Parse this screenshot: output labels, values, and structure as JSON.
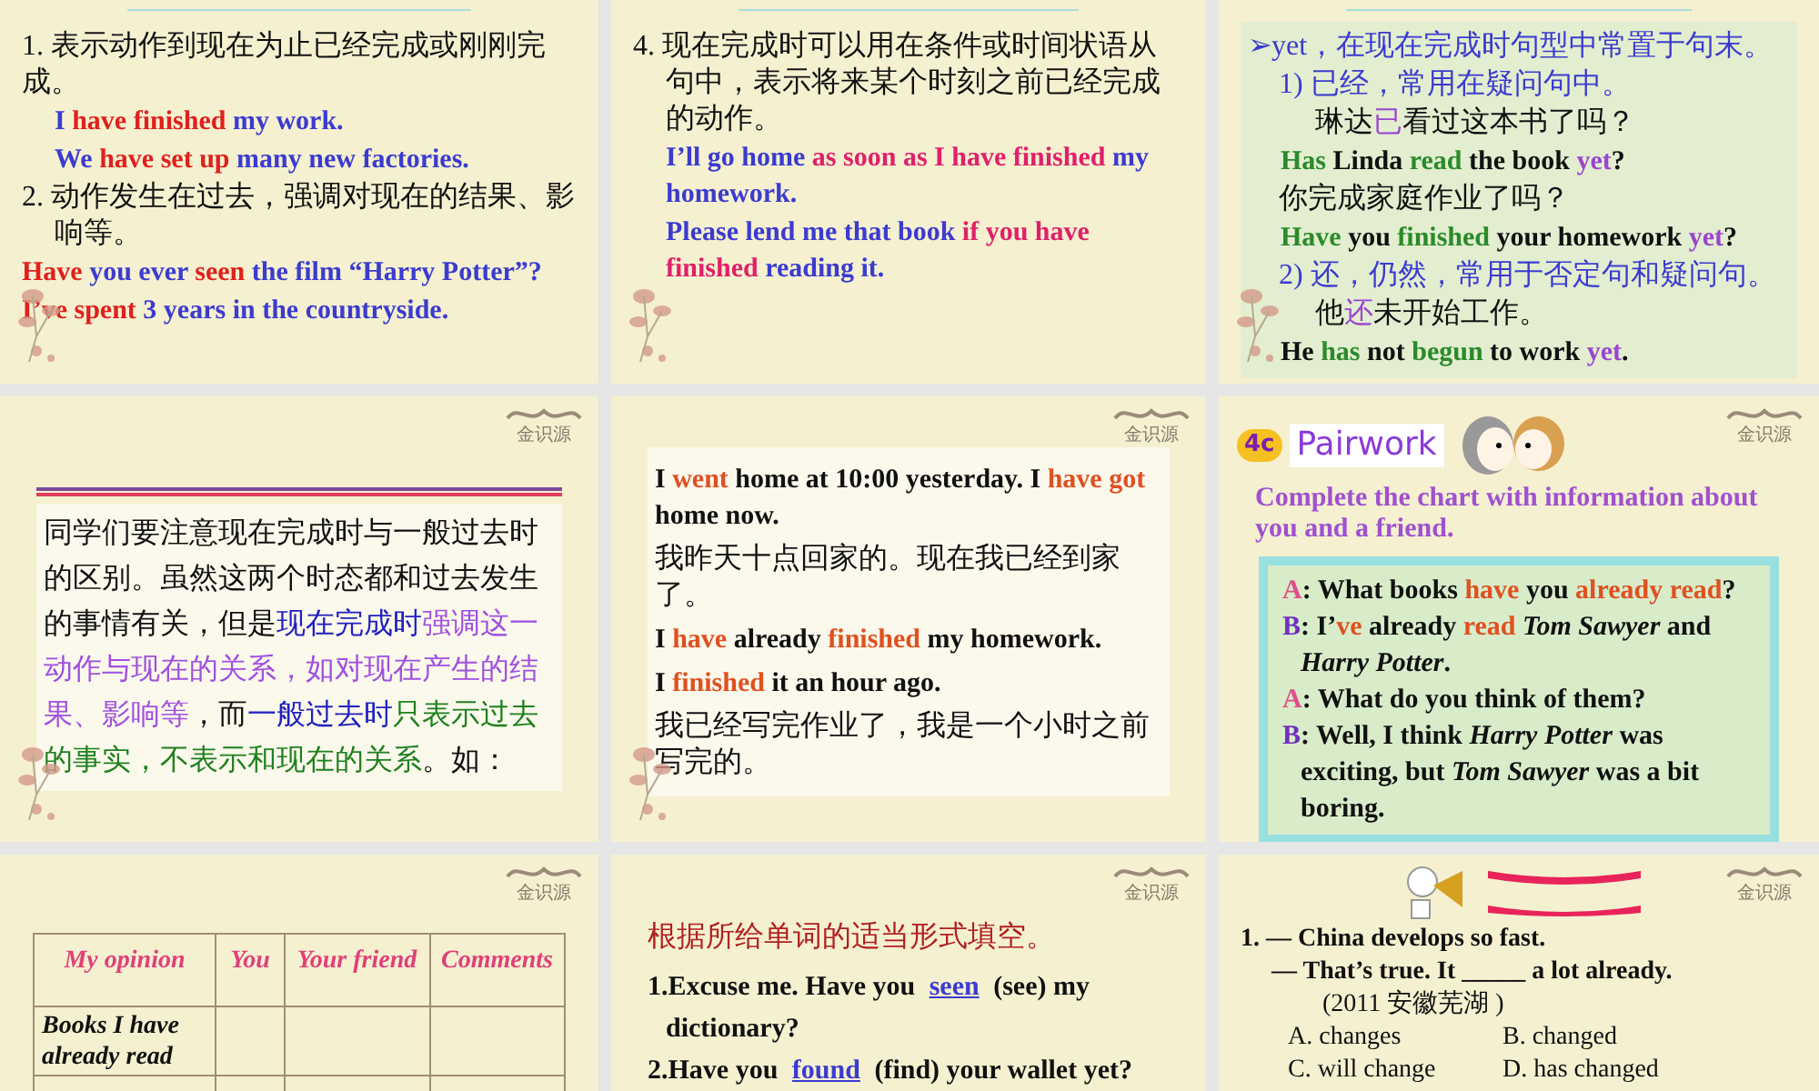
{
  "slides": [
    {
      "kind": "notes",
      "lines": [
        {
          "kind": "cn",
          "runs": [
            {
              "text": "1. 表示动作到现在为止已经完成或刚刚完成。",
              "color": "#111111"
            }
          ]
        },
        {
          "kind": "en-indent",
          "runs": [
            {
              "text": "I ",
              "color": "#3b3bd0"
            },
            {
              "text": "have finished",
              "color": "#e0201c"
            },
            {
              "text": " my work.",
              "color": "#3b3bd0"
            }
          ]
        },
        {
          "kind": "en-indent",
          "runs": [
            {
              "text": "We ",
              "color": "#3b3bd0"
            },
            {
              "text": "have set up",
              "color": "#e0201c"
            },
            {
              "text": " many new factories.",
              "color": "#3b3bd0"
            }
          ]
        },
        {
          "kind": "cn-hang",
          "runs": [
            {
              "text": "2. 动作发生在过去，强调对现在的结果、影响等。",
              "color": "#111111"
            }
          ]
        },
        {
          "kind": "en",
          "runs": [
            {
              "text": "Have",
              "color": "#e0201c"
            },
            {
              "text": " you ever ",
              "color": "#3b3bd0"
            },
            {
              "text": "seen",
              "color": "#e0201c"
            },
            {
              "text": " the film “Harry Potter”?",
              "color": "#3b3bd0"
            }
          ]
        },
        {
          "kind": "en",
          "runs": [
            {
              "text": "I’ve spent",
              "color": "#e0201c"
            },
            {
              "text": " 3 years in the countryside.",
              "color": "#3b3bd0"
            }
          ]
        }
      ]
    },
    {
      "kind": "notes",
      "lines": [
        {
          "kind": "cn-hang",
          "runs": [
            {
              "text": "4. 现在完成时可以用在条件或时间状语从句中，表示将来某个时刻之前已经完成的动作。",
              "color": "#111111"
            }
          ]
        },
        {
          "kind": "en-indent",
          "runs": [
            {
              "text": "I’ll go home ",
              "color": "#3b3bd0"
            },
            {
              "text": "as soon as I have finished",
              "color": "#e0206a"
            },
            {
              "text": " my homework.",
              "color": "#3b3bd0"
            }
          ]
        },
        {
          "kind": "en-indent",
          "runs": [
            {
              "text": "Please lend me that book ",
              "color": "#3b3bd0"
            },
            {
              "text": "if you have finished",
              "color": "#e0206a"
            },
            {
              "text": " reading it.",
              "color": "#3b3bd0"
            }
          ]
        }
      ]
    },
    {
      "kind": "notes-green",
      "lines": [
        {
          "kind": "cn",
          "runs": [
            {
              "text": "➢yet，在现在完成时句型中常置于句末。",
              "color": "#3b3bd0"
            }
          ]
        },
        {
          "kind": "cn-indent",
          "runs": [
            {
              "text": "1) 已经，常用在疑问句中。",
              "color": "#3b3bd0"
            }
          ]
        },
        {
          "kind": "cn-deep",
          "runs": [
            {
              "text": "琳达",
              "color": "#111111"
            },
            {
              "text": "已",
              "color": "#9b45d0"
            },
            {
              "text": "看过这本书了吗？",
              "color": "#111111"
            }
          ]
        },
        {
          "kind": "en-indent",
          "runs": [
            {
              "text": "Has",
              "color": "#2a8a2a"
            },
            {
              "text": " Linda ",
              "color": "#111111"
            },
            {
              "text": "read",
              "color": "#2a8a2a"
            },
            {
              "text": " the book ",
              "color": "#111111"
            },
            {
              "text": "yet",
              "color": "#9b45d0"
            },
            {
              "text": "?",
              "color": "#111111"
            }
          ]
        },
        {
          "kind": "cn-indent",
          "runs": [
            {
              "text": "你完成家庭作业了吗？",
              "color": "#111111"
            }
          ]
        },
        {
          "kind": "en-indent",
          "runs": [
            {
              "text": "Have",
              "color": "#2a8a2a"
            },
            {
              "text": " you ",
              "color": "#111111"
            },
            {
              "text": "finished",
              "color": "#2a8a2a"
            },
            {
              "text": " your homework ",
              "color": "#111111"
            },
            {
              "text": "yet",
              "color": "#9b45d0"
            },
            {
              "text": "?",
              "color": "#111111"
            }
          ]
        },
        {
          "kind": "cn-indent",
          "runs": [
            {
              "text": "2) 还，仍然，常用于否定句和疑问句。",
              "color": "#3b3bd0"
            }
          ]
        },
        {
          "kind": "cn-deep",
          "runs": [
            {
              "text": "他",
              "color": "#111111"
            },
            {
              "text": "还",
              "color": "#9b45d0"
            },
            {
              "text": "未开始工作。",
              "color": "#111111"
            }
          ]
        },
        {
          "kind": "en-indent",
          "runs": [
            {
              "text": "He ",
              "color": "#111111"
            },
            {
              "text": "has",
              "color": "#2a8a2a"
            },
            {
              "text": " not ",
              "color": "#111111"
            },
            {
              "text": "begun",
              "color": "#2a8a2a"
            },
            {
              "text": " to work ",
              "color": "#111111"
            },
            {
              "text": "yet",
              "color": "#9b45d0"
            },
            {
              "text": ".",
              "color": "#111111"
            }
          ]
        }
      ]
    },
    {
      "kind": "paragraph",
      "logo": "金识源",
      "runs": [
        {
          "text": "同学们要注意现在完成时与一般过去时的区别。虽然这两个时态都和过去发生的事情有关，但是",
          "color": "#111111"
        },
        {
          "text": "现在完成时",
          "color": "#2020c0"
        },
        {
          "text": "强调这一动作与现在的关系，如对现在产生的结果、影响等",
          "color": "#a050e0"
        },
        {
          "text": "，而",
          "color": "#111111"
        },
        {
          "text": "一般过去时",
          "color": "#2020c0"
        },
        {
          "text": "只表示过去的事实，不表示和现在的关系",
          "color": "#208020"
        },
        {
          "text": "。如：",
          "color": "#111111"
        }
      ]
    },
    {
      "kind": "notes-white",
      "logo": "金识源",
      "lines": [
        {
          "kind": "en",
          "runs": [
            {
              "text": "I ",
              "color": "#111111"
            },
            {
              "text": "went",
              "color": "#e05020"
            },
            {
              "text": " home at 10:00 yesterday. I ",
              "color": "#111111"
            },
            {
              "text": "have got",
              "color": "#e05020"
            },
            {
              "text": " home now.",
              "color": "#111111"
            }
          ]
        },
        {
          "kind": "cn",
          "runs": [
            {
              "text": "我昨天十点回家的。现在我已经到家了。",
              "color": "#111111"
            }
          ]
        },
        {
          "kind": "en",
          "runs": [
            {
              "text": "I ",
              "color": "#111111"
            },
            {
              "text": "have",
              "color": "#e05020"
            },
            {
              "text": " already ",
              "color": "#111111"
            },
            {
              "text": "finished",
              "color": "#e05020"
            },
            {
              "text": " my homework.",
              "color": "#111111"
            }
          ]
        },
        {
          "kind": "en",
          "runs": [
            {
              "text": "I ",
              "color": "#111111"
            },
            {
              "text": "finished",
              "color": "#e05020"
            },
            {
              "text": " it an hour ago.",
              "color": "#111111"
            }
          ]
        },
        {
          "kind": "cn",
          "runs": [
            {
              "text": "我已经写完作业了，我是一个小时之前写完的。",
              "color": "#111111"
            }
          ]
        }
      ]
    },
    {
      "kind": "pairwork",
      "logo": "金识源",
      "badge": "4c",
      "title": "Pairwork",
      "instruction": "Complete the chart with information about you and a friend.",
      "dialogue": [
        {
          "speaker": "A",
          "color": "#e0508a",
          "runs": [
            {
              "text": ": What books ",
              "color": "#111111"
            },
            {
              "text": "have",
              "color": "#e05020"
            },
            {
              "text": " you ",
              "color": "#111111"
            },
            {
              "text": "already read",
              "color": "#e05020"
            },
            {
              "text": "?",
              "color": "#111111"
            }
          ]
        },
        {
          "speaker": "B",
          "color": "#7030c0",
          "runs": [
            {
              "text": ": I’",
              "color": "#111111"
            },
            {
              "text": "ve",
              "color": "#e05020"
            },
            {
              "text": " already ",
              "color": "#111111"
            },
            {
              "text": "read",
              "color": "#e05020"
            },
            {
              "text": " Tom Sawyer",
              "color": "#111111",
              "italic": true
            },
            {
              "text": " and ",
              "color": "#111111"
            },
            {
              "text": "Harry Potter",
              "color": "#111111",
              "italic": true
            },
            {
              "text": ".",
              "color": "#111111"
            }
          ]
        },
        {
          "speaker": "A",
          "color": "#e0508a",
          "runs": [
            {
              "text": ": What do you think of them?",
              "color": "#111111"
            }
          ]
        },
        {
          "speaker": "B",
          "color": "#7030c0",
          "runs": [
            {
              "text": ": Well, I think ",
              "color": "#111111"
            },
            {
              "text": "Harry Potter",
              "color": "#111111",
              "italic": true
            },
            {
              "text": " was exciting, but ",
              "color": "#111111"
            },
            {
              "text": "Tom Sawyer",
              "color": "#111111",
              "italic": true
            },
            {
              "text": " was a bit boring.",
              "color": "#111111"
            }
          ]
        }
      ]
    },
    {
      "kind": "table",
      "logo": "金识源",
      "columns": [
        "My opinion",
        "You",
        "Your friend",
        "Comments"
      ],
      "rows": [
        "Books I have already read"
      ]
    },
    {
      "kind": "fill",
      "logo": "金识源",
      "title": "根据所给单词的适当形式填空。",
      "items": [
        {
          "before": "1.Excuse me. Have you ",
          "answer": "seen",
          "after": " (see) my dictionary?"
        },
        {
          "before": "2.Have you ",
          "answer": "found",
          "after": " (find) your wallet yet?"
        }
      ]
    },
    {
      "kind": "quiz",
      "logo": "金识源",
      "lines": [
        "1. — China develops so fast.",
        "— That’s true. It _____ a lot already.",
        "(2011 安徽芜湖 )"
      ],
      "options": [
        "A. changes",
        "B. changed",
        "C. will change",
        "D. has changed"
      ]
    }
  ]
}
